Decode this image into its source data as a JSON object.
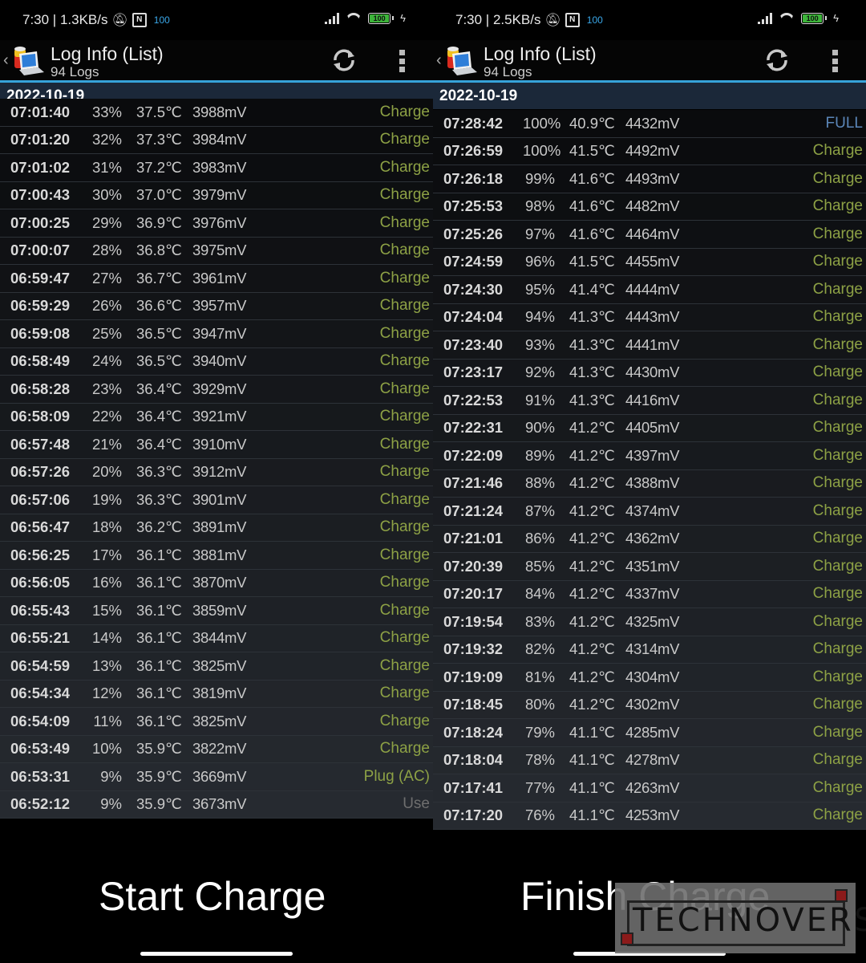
{
  "colors": {
    "accent": "#36a3d9",
    "date_header_bg": "#1b2839",
    "status_charge": "#8da145",
    "status_full": "#5b86b8",
    "status_use": "#6e6e6e",
    "battery_green": "#3db43a"
  },
  "left": {
    "statusbar": {
      "time_speed": "7:30 | 1.3KB/s",
      "nfc_label": "N",
      "badge": "100",
      "battery": "100",
      "icons": [
        "mute-bell-icon",
        "nfc-icon",
        "signal-icon",
        "wifi-icon",
        "battery-icon",
        "charging-bolt-icon"
      ]
    },
    "actionbar": {
      "title": "Log Info (List)",
      "subtitle": "94 Logs",
      "icons": [
        "back-icon",
        "app-battery-laptop-icon",
        "refresh-icon",
        "overflow-menu-icon"
      ]
    },
    "date": "2022-10-19",
    "rows": [
      {
        "time": "07:01:40",
        "pct": "33%",
        "temp": "37.5℃",
        "mv": "3988mV",
        "status": "Charge",
        "kind": "charge"
      },
      {
        "time": "07:01:20",
        "pct": "32%",
        "temp": "37.3℃",
        "mv": "3984mV",
        "status": "Charge",
        "kind": "charge"
      },
      {
        "time": "07:01:02",
        "pct": "31%",
        "temp": "37.2℃",
        "mv": "3983mV",
        "status": "Charge",
        "kind": "charge"
      },
      {
        "time": "07:00:43",
        "pct": "30%",
        "temp": "37.0℃",
        "mv": "3979mV",
        "status": "Charge",
        "kind": "charge"
      },
      {
        "time": "07:00:25",
        "pct": "29%",
        "temp": "36.9℃",
        "mv": "3976mV",
        "status": "Charge",
        "kind": "charge"
      },
      {
        "time": "07:00:07",
        "pct": "28%",
        "temp": "36.8℃",
        "mv": "3975mV",
        "status": "Charge",
        "kind": "charge"
      },
      {
        "time": "06:59:47",
        "pct": "27%",
        "temp": "36.7℃",
        "mv": "3961mV",
        "status": "Charge",
        "kind": "charge"
      },
      {
        "time": "06:59:29",
        "pct": "26%",
        "temp": "36.6℃",
        "mv": "3957mV",
        "status": "Charge",
        "kind": "charge"
      },
      {
        "time": "06:59:08",
        "pct": "25%",
        "temp": "36.5℃",
        "mv": "3947mV",
        "status": "Charge",
        "kind": "charge"
      },
      {
        "time": "06:58:49",
        "pct": "24%",
        "temp": "36.5℃",
        "mv": "3940mV",
        "status": "Charge",
        "kind": "charge"
      },
      {
        "time": "06:58:28",
        "pct": "23%",
        "temp": "36.4℃",
        "mv": "3929mV",
        "status": "Charge",
        "kind": "charge"
      },
      {
        "time": "06:58:09",
        "pct": "22%",
        "temp": "36.4℃",
        "mv": "3921mV",
        "status": "Charge",
        "kind": "charge"
      },
      {
        "time": "06:57:48",
        "pct": "21%",
        "temp": "36.4℃",
        "mv": "3910mV",
        "status": "Charge",
        "kind": "charge"
      },
      {
        "time": "06:57:26",
        "pct": "20%",
        "temp": "36.3℃",
        "mv": "3912mV",
        "status": "Charge",
        "kind": "charge"
      },
      {
        "time": "06:57:06",
        "pct": "19%",
        "temp": "36.3℃",
        "mv": "3901mV",
        "status": "Charge",
        "kind": "charge"
      },
      {
        "time": "06:56:47",
        "pct": "18%",
        "temp": "36.2℃",
        "mv": "3891mV",
        "status": "Charge",
        "kind": "charge"
      },
      {
        "time": "06:56:25",
        "pct": "17%",
        "temp": "36.1℃",
        "mv": "3881mV",
        "status": "Charge",
        "kind": "charge"
      },
      {
        "time": "06:56:05",
        "pct": "16%",
        "temp": "36.1℃",
        "mv": "3870mV",
        "status": "Charge",
        "kind": "charge"
      },
      {
        "time": "06:55:43",
        "pct": "15%",
        "temp": "36.1℃",
        "mv": "3859mV",
        "status": "Charge",
        "kind": "charge"
      },
      {
        "time": "06:55:21",
        "pct": "14%",
        "temp": "36.1℃",
        "mv": "3844mV",
        "status": "Charge",
        "kind": "charge"
      },
      {
        "time": "06:54:59",
        "pct": "13%",
        "temp": "36.1℃",
        "mv": "3825mV",
        "status": "Charge",
        "kind": "charge"
      },
      {
        "time": "06:54:34",
        "pct": "12%",
        "temp": "36.1℃",
        "mv": "3819mV",
        "status": "Charge",
        "kind": "charge"
      },
      {
        "time": "06:54:09",
        "pct": "11%",
        "temp": "36.1℃",
        "mv": "3825mV",
        "status": "Charge",
        "kind": "charge"
      },
      {
        "time": "06:53:49",
        "pct": "10%",
        "temp": "35.9℃",
        "mv": "3822mV",
        "status": "Charge",
        "kind": "charge"
      },
      {
        "time": "06:53:31",
        "pct": "9%",
        "temp": "35.9℃",
        "mv": "3669mV",
        "status": "Plug (AC)",
        "kind": "charge"
      },
      {
        "time": "06:52:12",
        "pct": "9%",
        "temp": "35.9℃",
        "mv": "3673mV",
        "status": "Use",
        "kind": "use"
      }
    ],
    "caption": "Start Charge"
  },
  "right": {
    "statusbar": {
      "time_speed": "7:30 | 2.5KB/s",
      "nfc_label": "N",
      "badge": "100",
      "battery": "100",
      "icons": [
        "mute-bell-icon",
        "nfc-icon",
        "signal-icon",
        "wifi-icon",
        "battery-icon",
        "charging-bolt-icon"
      ]
    },
    "actionbar": {
      "title": "Log Info (List)",
      "subtitle": "94 Logs",
      "icons": [
        "back-icon",
        "app-battery-laptop-icon",
        "refresh-icon",
        "overflow-menu-icon"
      ]
    },
    "date": "2022-10-19",
    "rows": [
      {
        "time": "07:28:42",
        "pct": "100%",
        "temp": "40.9℃",
        "mv": "4432mV",
        "status": "FULL",
        "kind": "full"
      },
      {
        "time": "07:26:59",
        "pct": "100%",
        "temp": "41.5℃",
        "mv": "4492mV",
        "status": "Charge",
        "kind": "charge"
      },
      {
        "time": "07:26:18",
        "pct": "99%",
        "temp": "41.6℃",
        "mv": "4493mV",
        "status": "Charge",
        "kind": "charge"
      },
      {
        "time": "07:25:53",
        "pct": "98%",
        "temp": "41.6℃",
        "mv": "4482mV",
        "status": "Charge",
        "kind": "charge"
      },
      {
        "time": "07:25:26",
        "pct": "97%",
        "temp": "41.6℃",
        "mv": "4464mV",
        "status": "Charge",
        "kind": "charge"
      },
      {
        "time": "07:24:59",
        "pct": "96%",
        "temp": "41.5℃",
        "mv": "4455mV",
        "status": "Charge",
        "kind": "charge"
      },
      {
        "time": "07:24:30",
        "pct": "95%",
        "temp": "41.4℃",
        "mv": "4444mV",
        "status": "Charge",
        "kind": "charge"
      },
      {
        "time": "07:24:04",
        "pct": "94%",
        "temp": "41.3℃",
        "mv": "4443mV",
        "status": "Charge",
        "kind": "charge"
      },
      {
        "time": "07:23:40",
        "pct": "93%",
        "temp": "41.3℃",
        "mv": "4441mV",
        "status": "Charge",
        "kind": "charge"
      },
      {
        "time": "07:23:17",
        "pct": "92%",
        "temp": "41.3℃",
        "mv": "4430mV",
        "status": "Charge",
        "kind": "charge"
      },
      {
        "time": "07:22:53",
        "pct": "91%",
        "temp": "41.3℃",
        "mv": "4416mV",
        "status": "Charge",
        "kind": "charge"
      },
      {
        "time": "07:22:31",
        "pct": "90%",
        "temp": "41.2℃",
        "mv": "4405mV",
        "status": "Charge",
        "kind": "charge"
      },
      {
        "time": "07:22:09",
        "pct": "89%",
        "temp": "41.2℃",
        "mv": "4397mV",
        "status": "Charge",
        "kind": "charge"
      },
      {
        "time": "07:21:46",
        "pct": "88%",
        "temp": "41.2℃",
        "mv": "4388mV",
        "status": "Charge",
        "kind": "charge"
      },
      {
        "time": "07:21:24",
        "pct": "87%",
        "temp": "41.2℃",
        "mv": "4374mV",
        "status": "Charge",
        "kind": "charge"
      },
      {
        "time": "07:21:01",
        "pct": "86%",
        "temp": "41.2℃",
        "mv": "4362mV",
        "status": "Charge",
        "kind": "charge"
      },
      {
        "time": "07:20:39",
        "pct": "85%",
        "temp": "41.2℃",
        "mv": "4351mV",
        "status": "Charge",
        "kind": "charge"
      },
      {
        "time": "07:20:17",
        "pct": "84%",
        "temp": "41.2℃",
        "mv": "4337mV",
        "status": "Charge",
        "kind": "charge"
      },
      {
        "time": "07:19:54",
        "pct": "83%",
        "temp": "41.2℃",
        "mv": "4325mV",
        "status": "Charge",
        "kind": "charge"
      },
      {
        "time": "07:19:32",
        "pct": "82%",
        "temp": "41.2℃",
        "mv": "4314mV",
        "status": "Charge",
        "kind": "charge"
      },
      {
        "time": "07:19:09",
        "pct": "81%",
        "temp": "41.2℃",
        "mv": "4304mV",
        "status": "Charge",
        "kind": "charge"
      },
      {
        "time": "07:18:45",
        "pct": "80%",
        "temp": "41.2℃",
        "mv": "4302mV",
        "status": "Charge",
        "kind": "charge"
      },
      {
        "time": "07:18:24",
        "pct": "79%",
        "temp": "41.1℃",
        "mv": "4285mV",
        "status": "Charge",
        "kind": "charge"
      },
      {
        "time": "07:18:04",
        "pct": "78%",
        "temp": "41.1℃",
        "mv": "4278mV",
        "status": "Charge",
        "kind": "charge"
      },
      {
        "time": "07:17:41",
        "pct": "77%",
        "temp": "41.1℃",
        "mv": "4263mV",
        "status": "Charge",
        "kind": "charge"
      },
      {
        "time": "07:17:20",
        "pct": "76%",
        "temp": "41.1℃",
        "mv": "4253mV",
        "status": "Charge",
        "kind": "charge"
      }
    ],
    "caption": "Finish Charge"
  },
  "watermark": {
    "text": "TECHNOVERSE"
  }
}
